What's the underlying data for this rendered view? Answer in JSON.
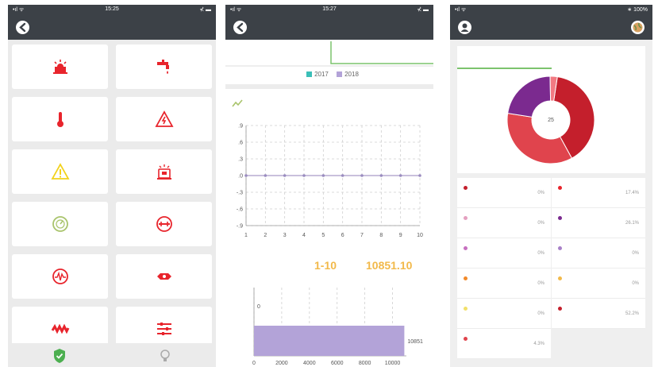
{
  "screen1": {
    "status": {
      "left": "•ıl ᯤ",
      "time": "15:25",
      "right": "⊀ ▬"
    },
    "icons": [
      "siren-icon",
      "water-tap-icon",
      "thermometer-icon",
      "high-voltage-warning-icon",
      "warning-triangle-icon",
      "alarm-device-icon",
      "gauge-icon",
      "pipe-icon",
      "waveform-icon",
      "sensor-icon",
      "heater-coil-icon",
      "settings-sliders-icon"
    ],
    "colors": {
      "red": "#e8242c",
      "yellow": "#f2d21b",
      "olive": "#a9c46c",
      "green": "#4caf50"
    }
  },
  "screen2": {
    "status": {
      "left": "•ıl ᯤ",
      "time": "15:27",
      "right": "⊀ ▬"
    },
    "legend": [
      {
        "label": "2017",
        "color": "#3bbfb8"
      },
      {
        "label": "2018",
        "color": "#b3a3d8"
      }
    ],
    "stat_range": "1-10",
    "stat_value": "10851.10",
    "bar_label": "0",
    "bar_value_label": "10851",
    "chart_data": [
      {
        "type": "line",
        "x": [
          1,
          2,
          3,
          4,
          5,
          6,
          7,
          8,
          9,
          10
        ],
        "series": [
          {
            "values": [
              0,
              0,
              0,
              0,
              0,
              0,
              0,
              0,
              0,
              0
            ]
          }
        ],
        "yticks": [
          ".9",
          ".6",
          ".3",
          ".0",
          "-.3",
          "-.6",
          "-.9"
        ],
        "ylim": [
          -0.9,
          0.9
        ],
        "grid": true
      },
      {
        "type": "bar",
        "orientation": "horizontal",
        "categories": [
          "0"
        ],
        "values": [
          10851
        ],
        "xticks": [
          "0",
          "2000",
          "4000",
          "6000",
          "8000",
          "10000"
        ],
        "xlim": [
          0,
          11000
        ],
        "color": "#b3a3d8"
      }
    ]
  },
  "screen3": {
    "status": {
      "left": "•ıl ᯤ",
      "time": "",
      "right": "∗ 100%"
    },
    "donut_center": "25",
    "chart_data": {
      "type": "pie",
      "values": [
        64.2,
        57.4,
        36.1,
        4.3
      ],
      "colors": [
        "#c41f2c",
        "#e0444d",
        "#7b2a8f",
        "#f27a82"
      ]
    },
    "left_cells": [
      {
        "color": "#c41f2c",
        "pct": "0%"
      },
      {
        "color": "#e4a0c0",
        "pct": "0%"
      },
      {
        "color": "#c670c0",
        "pct": "0%"
      },
      {
        "color": "#f28a2a",
        "pct": "0%"
      },
      {
        "color": "#f2e06a",
        "pct": "0%"
      },
      {
        "color": "#e0444d",
        "pct": "4.3%"
      }
    ],
    "right_cells": [
      {
        "color": "#e8242c",
        "pct": "17.4%"
      },
      {
        "color": "#7b2a8f",
        "pct": "26.1%"
      },
      {
        "color": "#a880c8",
        "pct": "0%"
      },
      {
        "color": "#f2b94a",
        "pct": "0%"
      },
      {
        "color": "#c41f2c",
        "pct": "52.2%"
      }
    ]
  }
}
